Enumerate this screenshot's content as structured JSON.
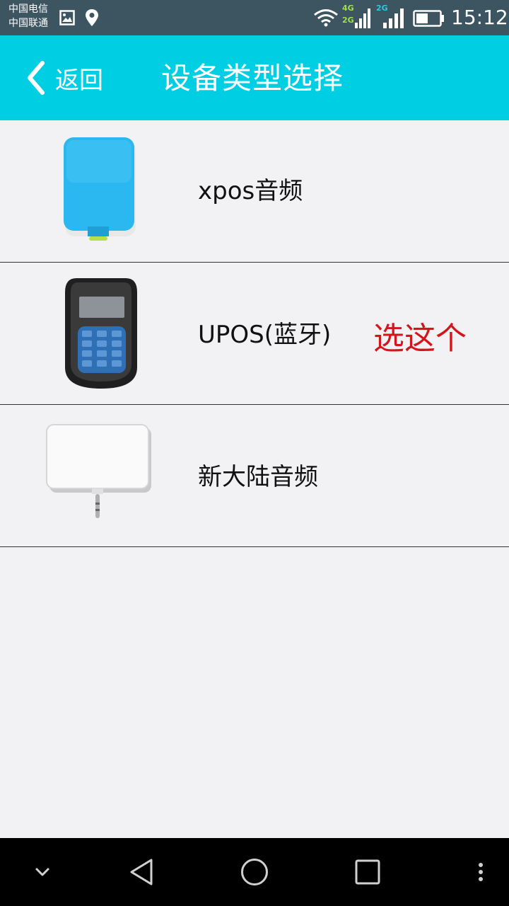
{
  "status_bar": {
    "carrier_1": "中国电信",
    "carrier_2": "中国联通",
    "net_1_top": "4G",
    "net_1_bottom": "2G",
    "net_2": "2G",
    "time": "15:12",
    "icons": [
      "image-icon",
      "location-icon",
      "wifi-icon",
      "signal-icon",
      "signal-icon",
      "battery-icon"
    ]
  },
  "app_bar": {
    "back_label": "返回",
    "title": "设备类型选择",
    "background_color": "#00cfe3"
  },
  "devices": [
    {
      "name": "xpos音频",
      "image": "blue-card-reader"
    },
    {
      "name": "UPOS(蓝牙)",
      "image": "black-keypad-pos"
    },
    {
      "name": "新大陆音频",
      "image": "white-audio-card-reader"
    }
  ],
  "annotation": {
    "text": "选这个",
    "color": "#d4161c"
  },
  "nav_bar": {
    "buttons": [
      "chevron-down-icon",
      "back-triangle-icon",
      "home-circle-icon",
      "recents-square-icon",
      "more-dots-icon"
    ]
  }
}
